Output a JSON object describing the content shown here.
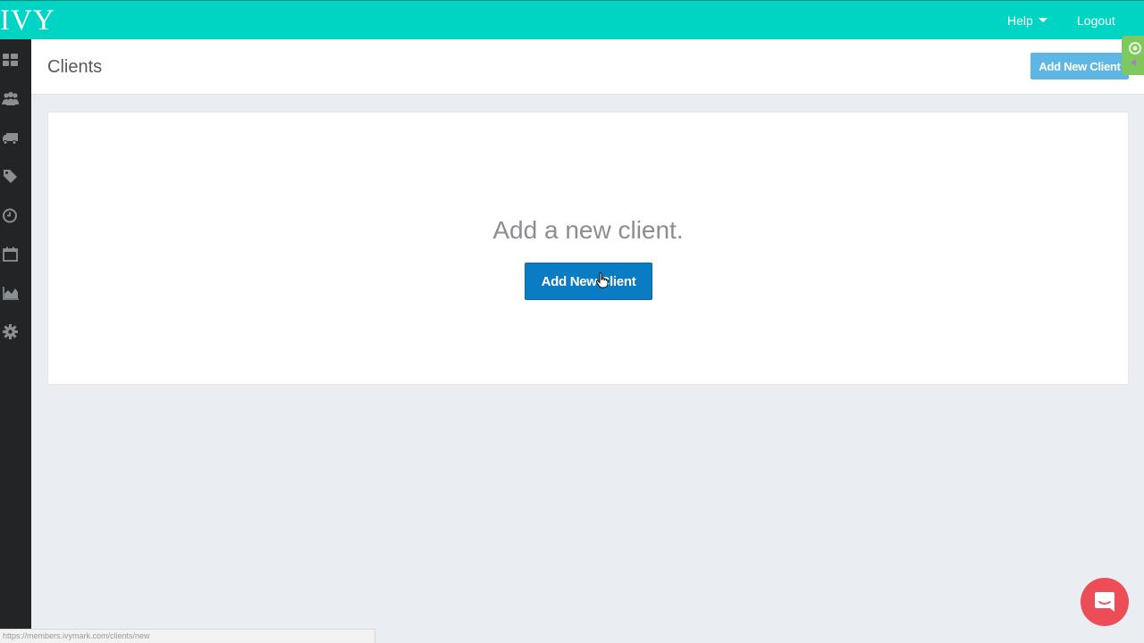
{
  "topbar": {
    "logo_text": "IVY",
    "help_label": "Help",
    "logout_label": "Logout",
    "background": "#00d4c2"
  },
  "sidebar": {
    "items": [
      {
        "icon": "dashboard-icon"
      },
      {
        "icon": "users-icon"
      },
      {
        "icon": "truck-icon"
      },
      {
        "icon": "tag-icon"
      },
      {
        "icon": "clock-icon"
      },
      {
        "icon": "calendar-icon"
      },
      {
        "icon": "area-chart-icon"
      },
      {
        "icon": "gear-icon"
      }
    ],
    "background": "#222425"
  },
  "page": {
    "title": "Clients",
    "header_button_label": "Add New Client"
  },
  "empty_state": {
    "message": "Add a new client.",
    "button_label": "Add New Client",
    "button_color": "#0a7cc4"
  },
  "chat": {
    "icon": "chat-icon",
    "color": "#ec4d57"
  },
  "status_bar": {
    "url": "https://members.ivymark.com/clients/new"
  }
}
